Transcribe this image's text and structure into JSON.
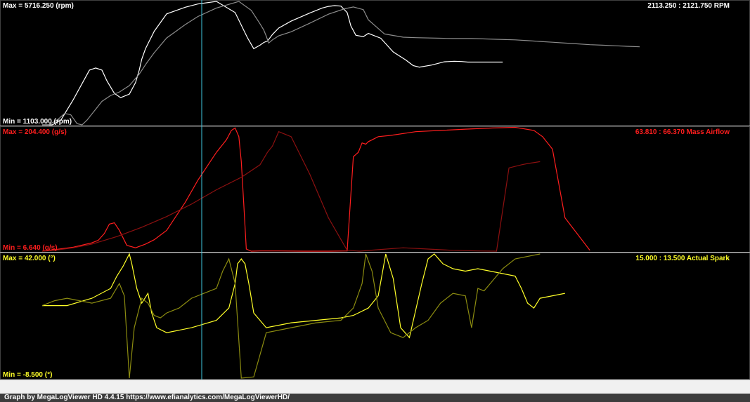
{
  "footer": {
    "text": "Graph by MegaLogViewer HD 4.4.15 https://www.efianalytics.com/MegaLogViewerHD/"
  },
  "chart_data": [
    {
      "type": "line",
      "title": "RPM",
      "readout": "2113.250 : 2121.750  RPM",
      "max_label": "Max = 5716.250 (rpm)",
      "min_label": "Min = 1103.000 (rpm)",
      "ylim": [
        1103.0,
        5716.25
      ],
      "color": "#ffffff",
      "color_dim": "#8c8c8c",
      "series": [
        {
          "role": "primary",
          "x": [
            0,
            8,
            15,
            25,
            38,
            43,
            48,
            52,
            58,
            63,
            70,
            75,
            78,
            80,
            83,
            90,
            100,
            115,
            125,
            140,
            155,
            165,
            170,
            175,
            178,
            180,
            181,
            185,
            190,
            200,
            215,
            225,
            230,
            235,
            240,
            245,
            248,
            252,
            258,
            262,
            272,
            282,
            292,
            298,
            303,
            313,
            323,
            331,
            337,
            342,
            358,
            370
          ],
          "y": [
            1103,
            1103,
            1280,
            2050,
            3150,
            3230,
            3150,
            2750,
            2280,
            2120,
            2250,
            2680,
            3150,
            3560,
            3950,
            4600,
            5250,
            5500,
            5620,
            5716,
            5300,
            4350,
            3950,
            4080,
            4180,
            4220,
            4230,
            4480,
            4720,
            4980,
            5280,
            5470,
            5530,
            5560,
            5540,
            5300,
            4800,
            4450,
            4400,
            4520,
            4340,
            3830,
            3530,
            3320,
            3260,
            3340,
            3460,
            3480,
            3470,
            3450,
            3450,
            3450
          ]
        },
        {
          "role": "secondary",
          "x": [
            0,
            5,
            12,
            18,
            23,
            28,
            32,
            36,
            42,
            48,
            55,
            62,
            70,
            78,
            84,
            90,
            100,
            115,
            125,
            140,
            158,
            168,
            175,
            178,
            180,
            182,
            185,
            190,
            200,
            215,
            230,
            243,
            250,
            258,
            262,
            275,
            290,
            300,
            320,
            330,
            345,
            365,
            380,
            390,
            400,
            410,
            420,
            430,
            440,
            450,
            460,
            470,
            480
          ],
          "y": [
            1103,
            1103,
            1280,
            1530,
            1480,
            1150,
            1103,
            1280,
            1630,
            1980,
            2200,
            2330,
            2570,
            3000,
            3420,
            3800,
            4350,
            4850,
            5150,
            5470,
            5716,
            5380,
            4880,
            4650,
            4420,
            4160,
            4280,
            4430,
            4580,
            4900,
            5240,
            5440,
            5510,
            5410,
            5030,
            4500,
            4380,
            4360,
            4340,
            4330,
            4330,
            4300,
            4280,
            4250,
            4220,
            4190,
            4160,
            4130,
            4100,
            4080,
            4060,
            4040,
            4020
          ]
        }
      ]
    },
    {
      "type": "line",
      "title": "Mass Airflow",
      "readout": "63.810 : 66.370  Mass Airflow",
      "max_label": "Max = 204.400 (g/s)",
      "min_label": "Min = 6.640 (g/s)",
      "ylim": [
        6.64,
        204.4
      ],
      "color": "#ff1e1e",
      "color_dim": "#8c1010",
      "series": [
        {
          "role": "primary",
          "x": [
            0,
            10,
            25,
            40,
            45,
            50,
            54,
            58,
            62,
            68,
            75,
            83,
            90,
            100,
            115,
            125,
            140,
            148,
            152,
            155,
            158,
            160,
            162,
            164,
            168,
            175,
            190,
            210,
            230,
            245,
            250,
            254,
            257,
            260,
            262,
            265,
            270,
            280,
            300,
            320,
            340,
            362,
            380,
            395,
            402,
            410,
            420,
            440
          ],
          "y": [
            6.6,
            9,
            13,
            20,
            24,
            35,
            50,
            52,
            40,
            16,
            12,
            18,
            25,
            40,
            85,
            120,
            165,
            185,
            200,
            204,
            190,
            150,
            80,
            10,
            6.6,
            7,
            7,
            6.6,
            6.6,
            7,
            158,
            165,
            180,
            178,
            182,
            185,
            190,
            192,
            198,
            200,
            202,
            204,
            205,
            200,
            190,
            170,
            60,
            8
          ]
        },
        {
          "role": "secondary",
          "x": [
            0,
            10,
            25,
            40,
            60,
            80,
            100,
            120,
            140,
            160,
            175,
            181,
            185,
            190,
            200,
            215,
            230,
            245,
            255,
            270,
            290,
            310,
            330,
            350,
            365,
            375,
            385,
            390,
            400
          ],
          "y": [
            6.6,
            8,
            12,
            18,
            30,
            45,
            62,
            82,
            105,
            125,
            145,
            165,
            175,
            198,
            190,
            130,
            60,
            8,
            6.6,
            9,
            12,
            10,
            8,
            7,
            6.6,
            140,
            145,
            147,
            150
          ]
        }
      ]
    },
    {
      "type": "line",
      "title": "Actual Spark",
      "readout": "15.000 : 13.500  Actual Spark",
      "max_label": "Max = 42.000 (°)",
      "min_label": "Min = -8.500 (°)",
      "ylim": [
        -8.5,
        42.0
      ],
      "color": "#ffff28",
      "color_dim": "#8c8c10",
      "series": [
        {
          "role": "primary",
          "x": [
            0,
            20,
            40,
            55,
            60,
            65,
            70,
            72,
            76,
            80,
            85,
            88,
            92,
            100,
            120,
            140,
            150,
            155,
            157,
            160,
            163,
            166,
            170,
            180,
            200,
            220,
            240,
            250,
            262,
            270,
            276,
            282,
            288,
            295,
            305,
            310,
            315,
            322,
            330,
            340,
            350,
            360,
            370,
            380,
            385,
            390,
            395,
            400,
            410,
            420
          ],
          "y": [
            21,
            21,
            24,
            28,
            33,
            37,
            42,
            38,
            28,
            22,
            26,
            18,
            12,
            10,
            12,
            15,
            20,
            30,
            38,
            40,
            38,
            30,
            18,
            12,
            14,
            15,
            16,
            17,
            20,
            25,
            42,
            32,
            12,
            8,
            30,
            40,
            42,
            38,
            36,
            35,
            36,
            35,
            34,
            33,
            28,
            22,
            20,
            24,
            25,
            26
          ]
        },
        {
          "role": "secondary",
          "x": [
            0,
            10,
            20,
            30,
            40,
            55,
            62,
            66,
            70,
            74,
            80,
            85,
            90,
            95,
            100,
            105,
            110,
            115,
            120,
            130,
            140,
            145,
            150,
            155,
            160,
            170,
            180,
            200,
            220,
            240,
            250,
            257,
            260,
            265,
            270,
            280,
            290,
            300,
            310,
            320,
            330,
            340,
            345,
            350,
            355,
            360,
            370,
            380,
            400
          ],
          "y": [
            21,
            23,
            24,
            23,
            22,
            24,
            30,
            25,
            -8.5,
            12,
            24,
            22,
            17,
            16,
            18,
            19,
            20,
            22,
            24,
            26,
            28,
            35,
            40,
            30,
            -8.5,
            -8,
            10,
            12,
            14,
            15,
            20,
            30,
            42,
            35,
            20,
            10,
            8,
            12,
            15,
            22,
            26,
            25,
            12,
            28,
            27,
            30,
            36,
            40,
            42
          ]
        }
      ]
    }
  ]
}
